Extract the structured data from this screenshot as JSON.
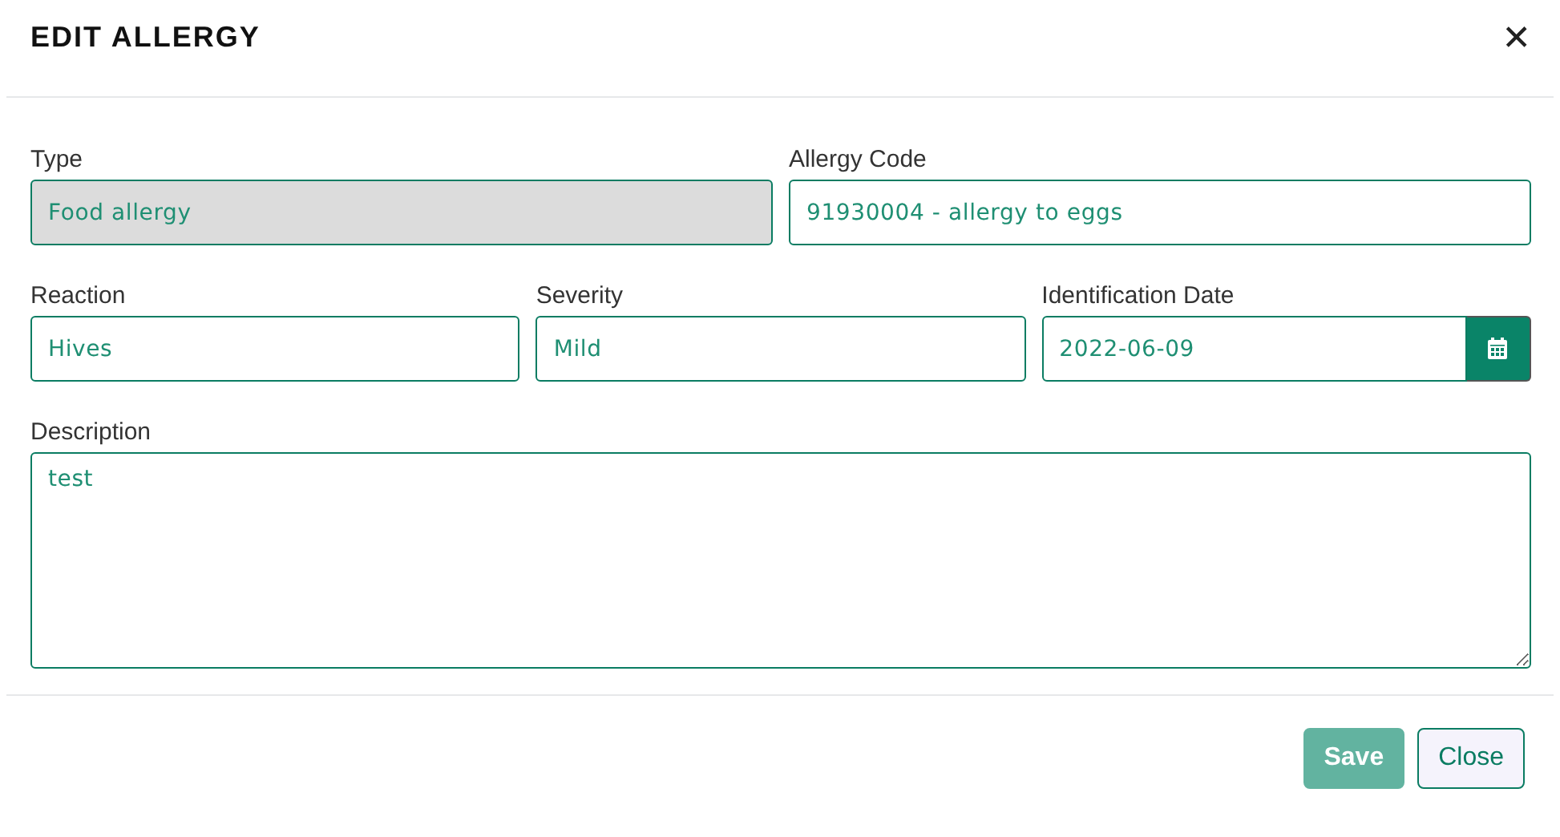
{
  "dialog": {
    "title": "EDIT ALLERGY",
    "close_icon": "✕"
  },
  "rows": [
    [
      {
        "kind": "text",
        "label": "Type",
        "value": "Food allergy",
        "disabled": true
      },
      {
        "kind": "text",
        "label": "Allergy Code",
        "value": "91930004 - allergy to eggs",
        "disabled": false
      }
    ],
    [
      {
        "kind": "text",
        "label": "Reaction",
        "value": "Hives",
        "disabled": false
      },
      {
        "kind": "text",
        "label": "Severity",
        "value": "Mild",
        "disabled": false
      },
      {
        "kind": "date",
        "label": "Identification Date",
        "value": "2022-06-09",
        "disabled": false
      }
    ],
    [
      {
        "kind": "textarea",
        "label": "Description",
        "value": "test",
        "disabled": false
      }
    ]
  ],
  "buttons": [
    {
      "kind": "primary",
      "label": "Save",
      "disabled": true
    },
    {
      "kind": "secondary",
      "label": "Close",
      "disabled": false
    }
  ]
}
